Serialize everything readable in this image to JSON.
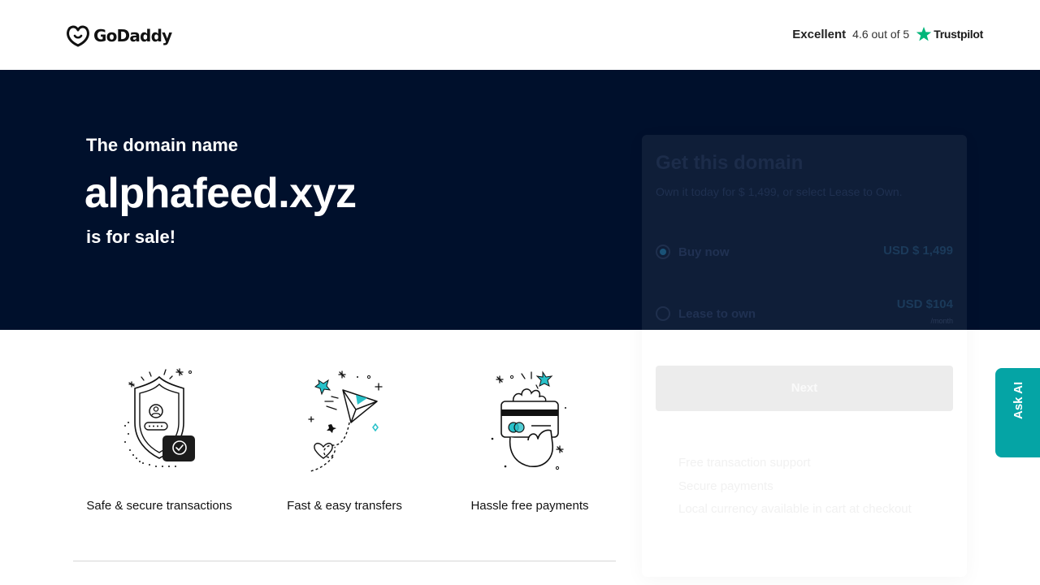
{
  "header": {
    "logo_text": "GoDaddy",
    "logo_icon": "godaddy-logo-icon",
    "rating_label": "Excellent",
    "rating_score": "4.6 out of 5",
    "trustpilot_label": "Trustpilot",
    "trustpilot_icon": "star-icon",
    "trustpilot_color": "#00b67a"
  },
  "hero": {
    "pre_text": "The domain name",
    "domain": "alphafeed.xyz",
    "post_text": "is for sale!",
    "background": "#00102c"
  },
  "features": [
    {
      "icon": "shield-user-icon",
      "label": "Safe & secure transactions"
    },
    {
      "icon": "paper-plane-icon",
      "label": "Fast & easy transfers"
    },
    {
      "icon": "card-payment-icon",
      "label": "Hassle free payments"
    }
  ],
  "card": {
    "title": "Get this domain",
    "subtitle": "Own it today for $ 1,499, or select Lease to Own.",
    "options": [
      {
        "label": "Buy now",
        "price": "USD $ 1,499",
        "selected": true
      },
      {
        "label": "Lease to own",
        "price": "USD $104",
        "unit": "/month",
        "selected": false
      }
    ],
    "next_label": "Next",
    "bullets": [
      "Free transaction support",
      "Secure payments",
      "Local currency available in cart at checkout"
    ]
  },
  "ask_ai": {
    "label": "Ask AI",
    "color": "#05a4a5"
  }
}
